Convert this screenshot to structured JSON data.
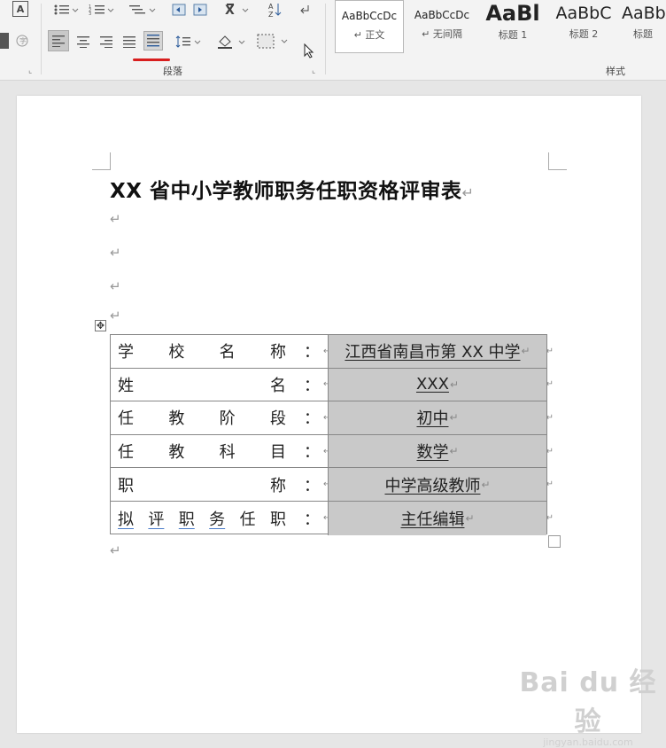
{
  "ribbon": {
    "paragraph_group_label": "段落",
    "styles_group_label": "样式",
    "styles": [
      {
        "sample": "AaBbCcDc",
        "name": "↵ 正文"
      },
      {
        "sample": "AaBbCcDc",
        "name": "↵ 无间隔"
      },
      {
        "sample": "AaBl",
        "name": "标题 1"
      },
      {
        "sample": "AaBbC",
        "name": "标题 2"
      },
      {
        "sample": "AaBb",
        "name": "标题"
      }
    ],
    "active_underline_color": "#d81e1e",
    "font_color_label": "A"
  },
  "document": {
    "title": "XX 省中小学教师职务任职资格评审表",
    "paragraph_mark": "↵",
    "move_handle": "✥",
    "table": [
      {
        "label_chars": [
          "学",
          "校",
          "名",
          "称"
        ],
        "colon": "：",
        "value": "江西省南昌市第 XX 中学"
      },
      {
        "label_chars": [
          "姓",
          "名"
        ],
        "colon": "：",
        "value": "XXX"
      },
      {
        "label_chars": [
          "任",
          "教",
          "阶",
          "段"
        ],
        "colon": "：",
        "value": "初中"
      },
      {
        "label_chars": [
          "任",
          "教",
          "科",
          "目"
        ],
        "colon": "：",
        "value": "数学"
      },
      {
        "label_chars": [
          "职",
          "称"
        ],
        "colon": "：",
        "value": "中学高级教师"
      },
      {
        "label_chars": [
          "拟",
          "评",
          "职",
          "务",
          "任",
          "职"
        ],
        "colon": "：",
        "value": "主任编辑"
      }
    ]
  },
  "watermark": {
    "main": "Bai du 经验",
    "sub": "jingyan.baidu.com"
  }
}
